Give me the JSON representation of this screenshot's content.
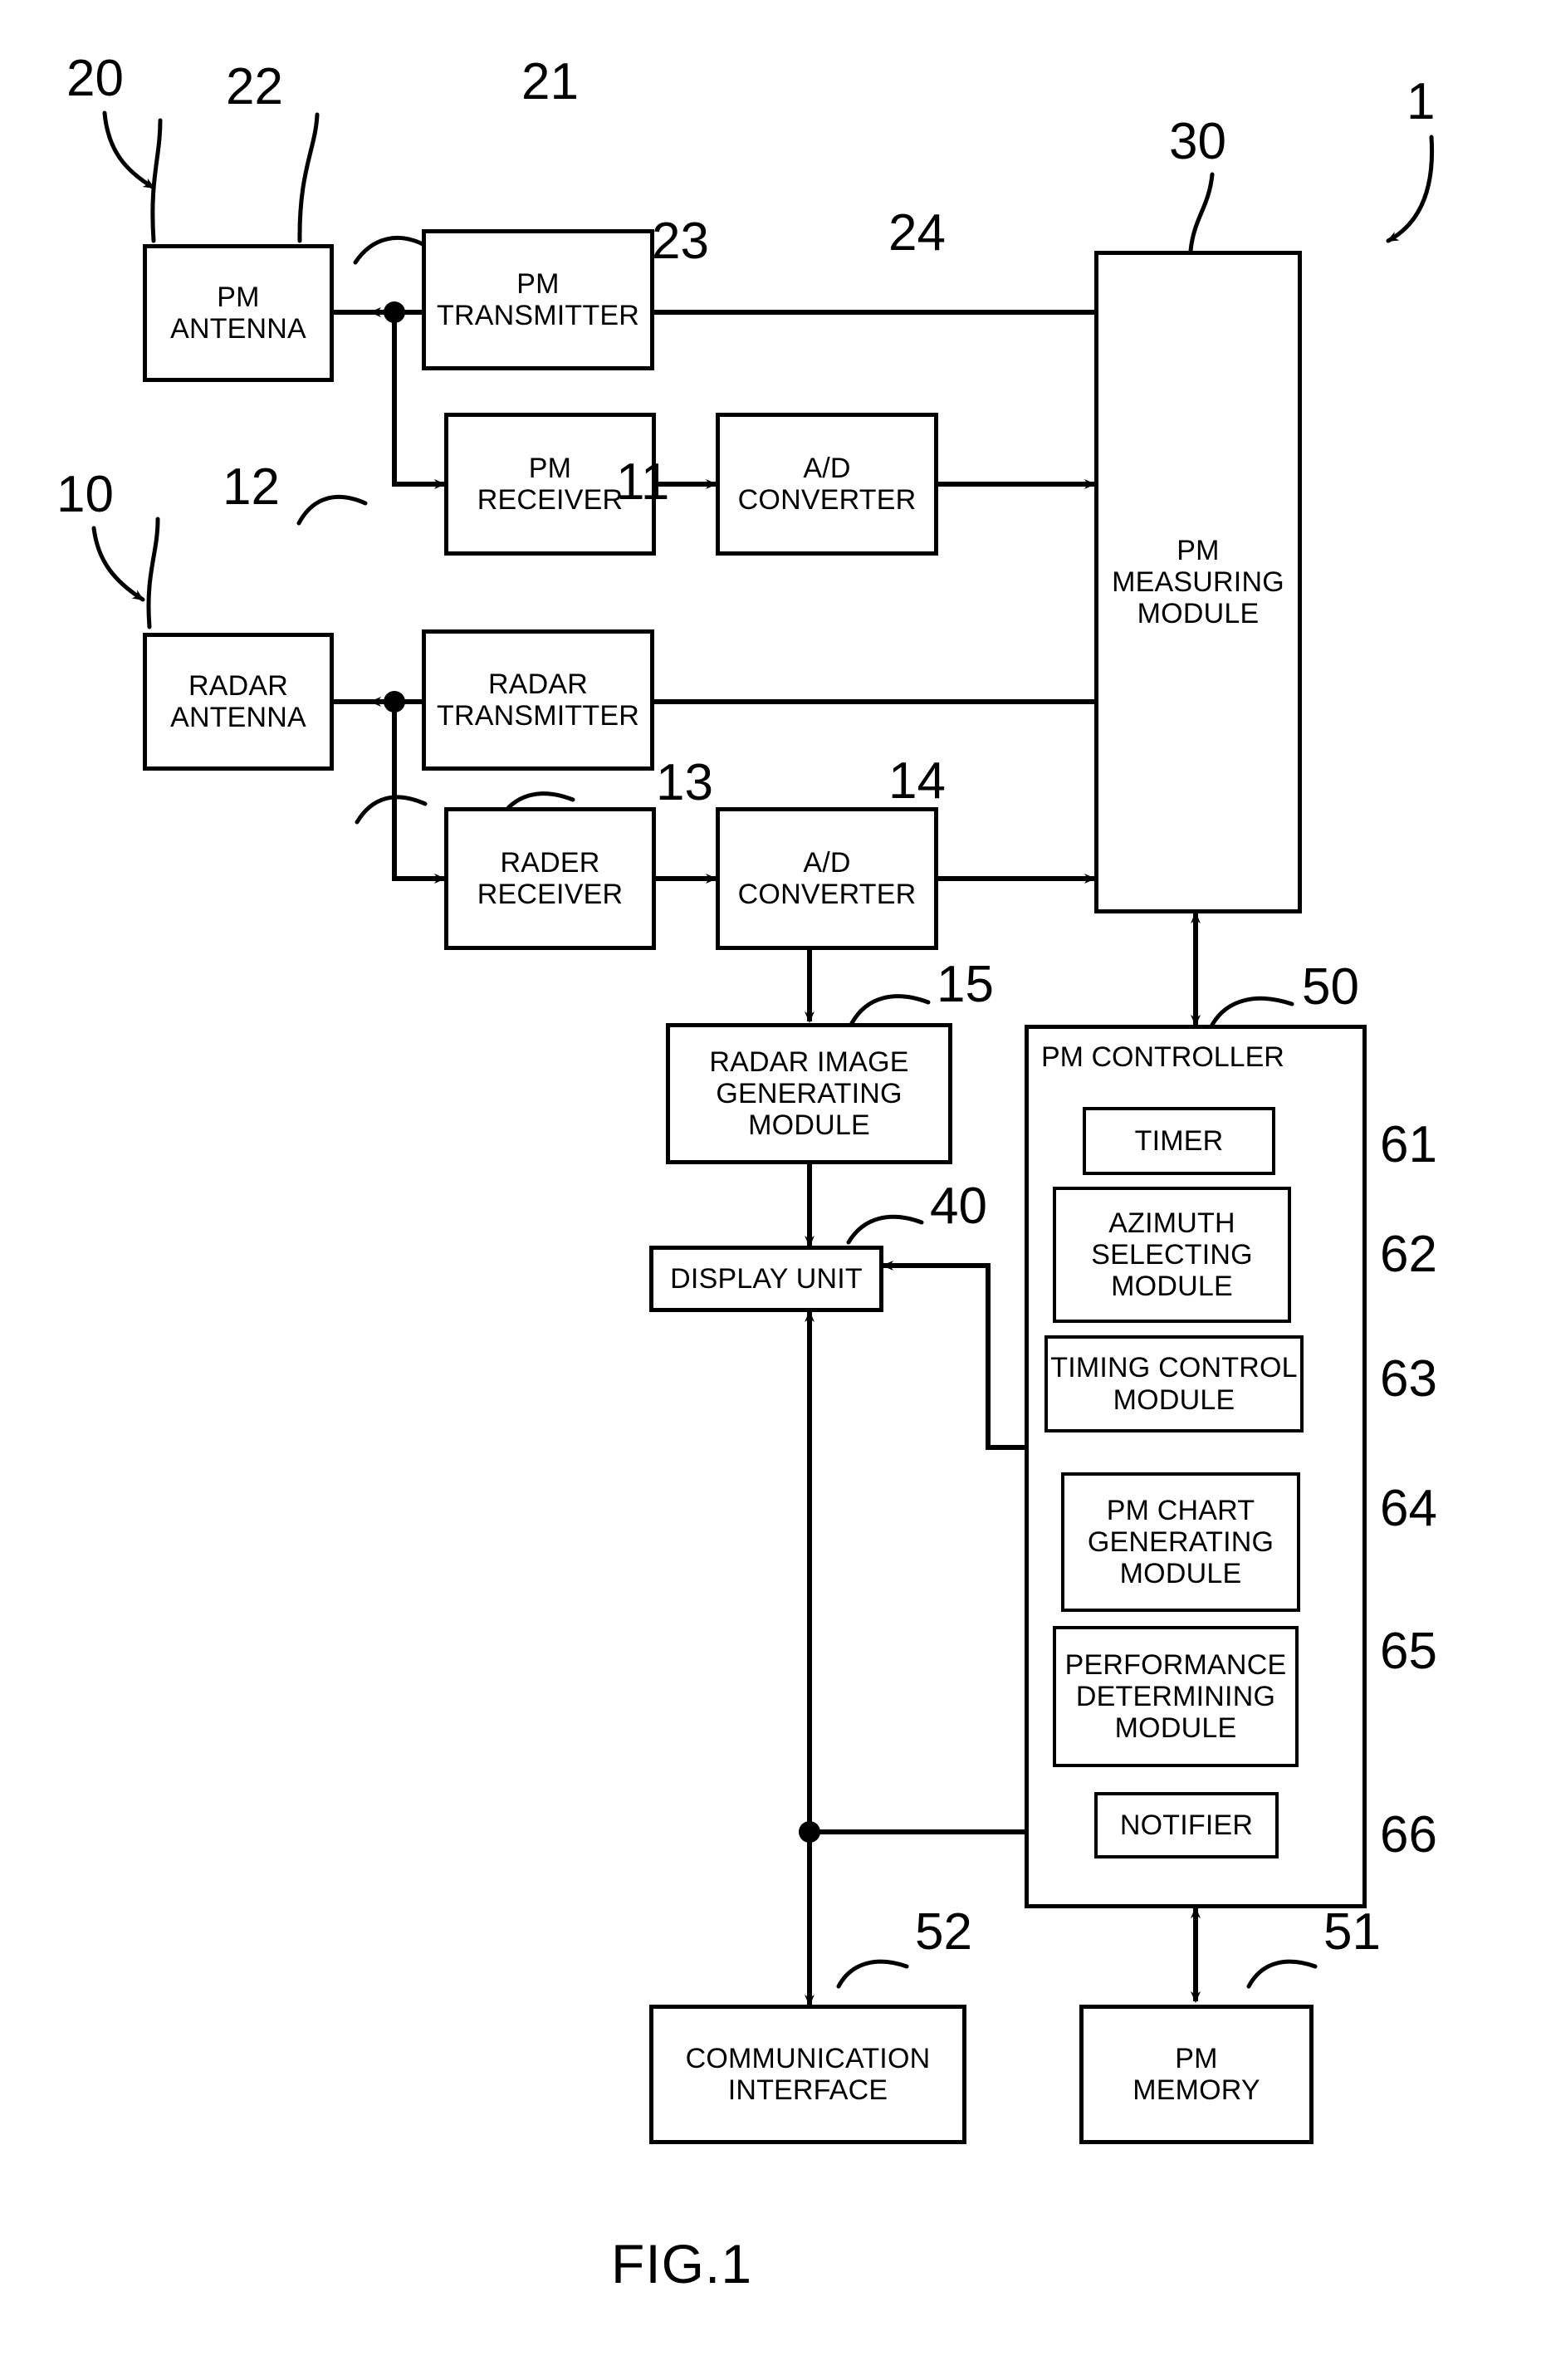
{
  "figure": {
    "caption": "FIG.1",
    "system_ref": "1"
  },
  "groups": [
    {
      "id": "pm-subsystem",
      "ref": "20"
    },
    {
      "id": "radar-subsystem",
      "ref": "10"
    }
  ],
  "blocks": [
    {
      "id": "pm-antenna",
      "label": "PM\nANTENNA",
      "ref": "22"
    },
    {
      "id": "pm-transmitter",
      "label": "PM\nTRANSMITTER",
      "ref": "21"
    },
    {
      "id": "pm-receiver",
      "label": "PM\nRECEIVER",
      "ref": "23"
    },
    {
      "id": "pm-ad-converter",
      "label": "A/D\nCONVERTER",
      "ref": "24"
    },
    {
      "id": "pm-measuring",
      "label": "PM\nMEASURING\nMODULE",
      "ref": "30"
    },
    {
      "id": "radar-antenna",
      "label": "RADAR\nANTENNA",
      "ref": "12"
    },
    {
      "id": "radar-transmitter",
      "label": "RADAR\nTRANSMITTER",
      "ref": "11"
    },
    {
      "id": "radar-receiver",
      "label": "RADER\nRECEIVER",
      "ref": "13"
    },
    {
      "id": "radar-ad-converter",
      "label": "A/D\nCONVERTER",
      "ref": "14"
    },
    {
      "id": "radar-image-gen",
      "label": "RADAR IMAGE\nGENERATING\nMODULE",
      "ref": "15"
    },
    {
      "id": "display-unit",
      "label": "DISPLAY UNIT",
      "ref": "40"
    },
    {
      "id": "pm-controller",
      "label": "PM CONTROLLER",
      "ref": "50"
    },
    {
      "id": "timer",
      "label": "TIMER",
      "ref": "61"
    },
    {
      "id": "azimuth-selecting",
      "label": "AZIMUTH\nSELECTING\nMODULE",
      "ref": "62"
    },
    {
      "id": "timing-control",
      "label": "TIMING CONTROL\nMODULE",
      "ref": "63"
    },
    {
      "id": "pm-chart-gen",
      "label": "PM CHART\nGENERATING\nMODULE",
      "ref": "64"
    },
    {
      "id": "performance-det",
      "label": "PERFORMANCE\nDETERMINING\nMODULE",
      "ref": "65"
    },
    {
      "id": "notifier",
      "label": "NOTIFIER",
      "ref": "66"
    },
    {
      "id": "comm-interface",
      "label": "COMMUNICATION\nINTERFACE",
      "ref": "52"
    },
    {
      "id": "pm-memory",
      "label": "PM\nMEMORY",
      "ref": "51"
    }
  ],
  "colors": {
    "line": "#000000",
    "background": "#ffffff"
  }
}
